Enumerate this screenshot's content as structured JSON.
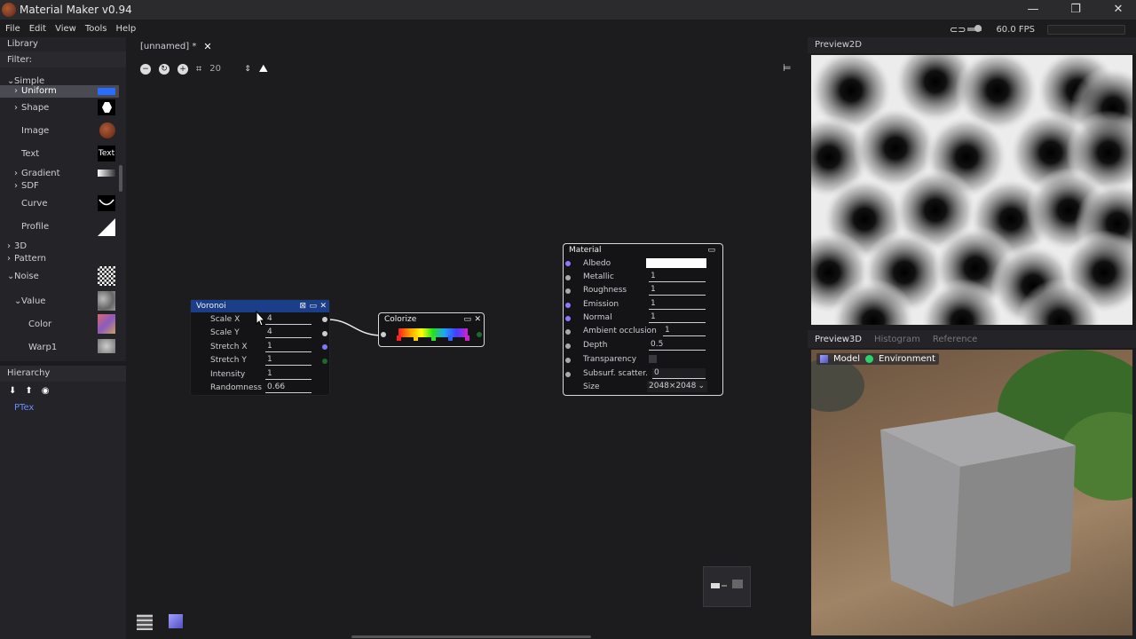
{
  "window": {
    "title": "Material Maker v0.94",
    "minimize": "—",
    "restore": "❐",
    "close": "✕"
  },
  "menu": [
    "File",
    "Edit",
    "View",
    "Tools",
    "Help"
  ],
  "fps": "60.0 FPS",
  "library": {
    "title": "Library",
    "filter_label": "Filter:",
    "items": [
      {
        "label": "Simple",
        "arrow": "⌄"
      },
      {
        "label": "Uniform",
        "arrow": "›"
      },
      {
        "label": "Shape",
        "arrow": "›"
      },
      {
        "label": "Image",
        "arrow": ""
      },
      {
        "label": "Text",
        "arrow": "",
        "preview_text": "Text"
      },
      {
        "label": "Gradient",
        "arrow": "›"
      },
      {
        "label": "SDF",
        "arrow": "›"
      },
      {
        "label": "Curve",
        "arrow": ""
      },
      {
        "label": "Profile",
        "arrow": ""
      },
      {
        "label": "3D",
        "arrow": "›"
      },
      {
        "label": "Pattern",
        "arrow": "›"
      },
      {
        "label": "Noise",
        "arrow": "⌄"
      },
      {
        "label": "Value",
        "arrow": "⌄"
      },
      {
        "label": "Color",
        "arrow": ""
      },
      {
        "label": "Warp1",
        "arrow": ""
      }
    ]
  },
  "hierarchy": {
    "title": "Hierarchy",
    "item": "PTex"
  },
  "graph": {
    "tab_label": "[unnamed] *",
    "grid_value": "20",
    "voronoi": {
      "title": "Voronoi",
      "rows": [
        {
          "label": "Scale X",
          "value": "4"
        },
        {
          "label": "Scale Y",
          "value": "4"
        },
        {
          "label": "Stretch X",
          "value": "1"
        },
        {
          "label": "Stretch Y",
          "value": "1"
        },
        {
          "label": "Intensity",
          "value": "1"
        },
        {
          "label": "Randomness",
          "value": "0.66"
        }
      ]
    },
    "colorize": {
      "title": "Colorize"
    },
    "material": {
      "title": "Material",
      "rows": [
        {
          "label": "Albedo",
          "value": ""
        },
        {
          "label": "Metallic",
          "value": "1"
        },
        {
          "label": "Roughness",
          "value": "1"
        },
        {
          "label": "Emission",
          "value": "1"
        },
        {
          "label": "Normal",
          "value": "1"
        },
        {
          "label": "Ambient occlusion",
          "value": "1"
        },
        {
          "label": "Depth",
          "value": "0.5"
        },
        {
          "label": "Transparency",
          "value": ""
        },
        {
          "label": "Subsurf. scatter.",
          "value": "0"
        },
        {
          "label": "Size",
          "value": "2048×2048"
        }
      ]
    }
  },
  "preview2d": {
    "title": "Preview2D"
  },
  "preview3d": {
    "tabs": [
      "Preview3D",
      "Histogram",
      "Reference"
    ],
    "model_label": "Model",
    "environment_label": "Environment"
  }
}
